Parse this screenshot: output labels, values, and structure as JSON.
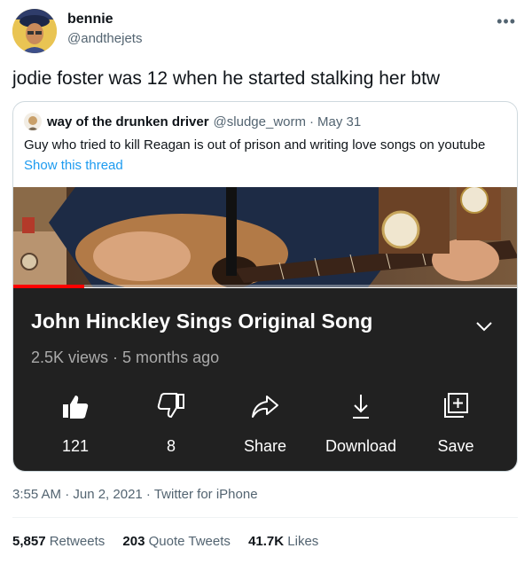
{
  "author": {
    "name": "bennie",
    "handle": "@andthejets"
  },
  "icons": {
    "more": "more-horizontal-icon"
  },
  "tweet": {
    "text": "jodie foster was 12 when he started stalking her btw"
  },
  "quote": {
    "name": "way of the drunken driver",
    "handle": "@sludge_worm",
    "dot": "·",
    "date": "May 31",
    "text": "Guy who tried to kill Reagan is out of prison and writing love songs on youtube",
    "show_thread": "Show this thread"
  },
  "video": {
    "title": "John Hinckley Sings Original Song",
    "meta": "2.5K views · 5 months ago",
    "progress": 0.14,
    "actions": {
      "like": {
        "label": "121",
        "icon": "thumbs-up-icon"
      },
      "dislike": {
        "label": "8",
        "icon": "thumbs-down-icon"
      },
      "share": {
        "label": "Share",
        "icon": "share-arrow-icon"
      },
      "download": {
        "label": "Download",
        "icon": "download-icon"
      },
      "save": {
        "label": "Save",
        "icon": "save-playlist-icon"
      }
    },
    "colors": {
      "panel": "#212121",
      "progress": "#ff0000"
    }
  },
  "footer": {
    "timestamp": "3:55 AM · Jun 2, 2021 · Twitter for iPhone",
    "retweets_count": "5,857",
    "retweets_label": "Retweets",
    "quotes_count": "203",
    "quotes_label": "Quote Tweets",
    "likes_count": "41.7K",
    "likes_label": "Likes"
  }
}
